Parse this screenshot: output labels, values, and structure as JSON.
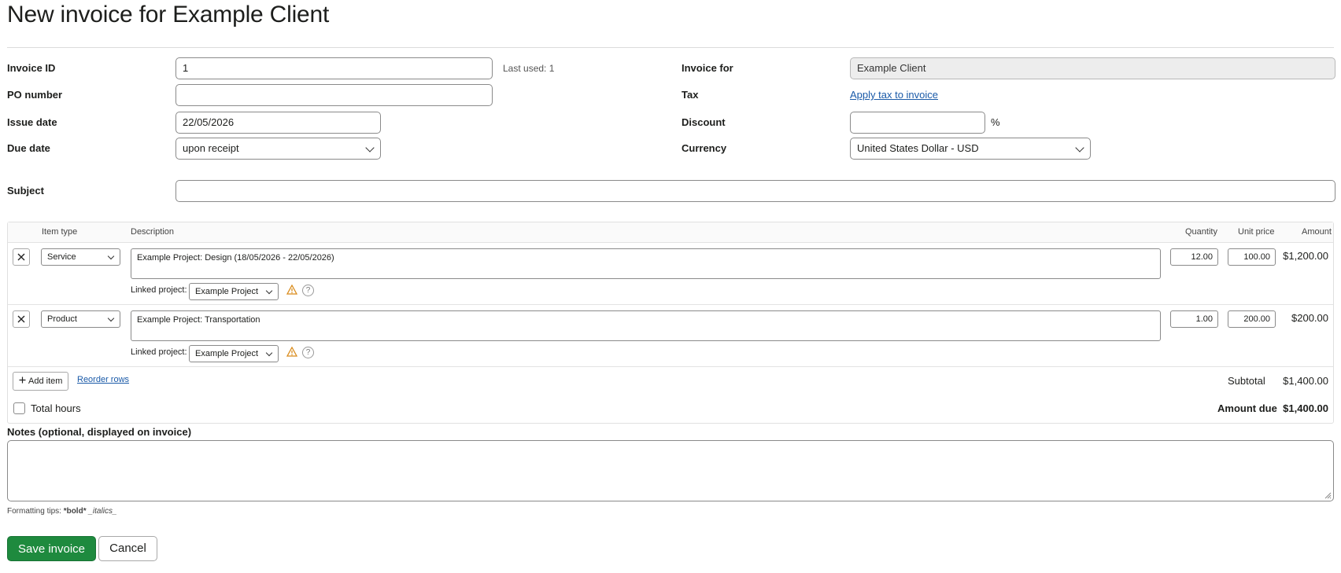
{
  "page": {
    "title": "New invoice for Example Client"
  },
  "form": {
    "invoice_id": {
      "label": "Invoice ID",
      "value": "1",
      "last_used": "Last used: 1"
    },
    "po_number": {
      "label": "PO number",
      "value": ""
    },
    "issue_date": {
      "label": "Issue date",
      "value": "22/05/2026"
    },
    "due_date": {
      "label": "Due date",
      "value": "upon receipt"
    },
    "invoice_for": {
      "label": "Invoice for",
      "value": "Example Client"
    },
    "tax": {
      "label": "Tax",
      "link": "Apply tax to invoice"
    },
    "discount": {
      "label": "Discount",
      "value": "",
      "suffix": "%"
    },
    "currency": {
      "label": "Currency",
      "value": "United States Dollar - USD"
    },
    "subject": {
      "label": "Subject",
      "value": ""
    }
  },
  "items": {
    "headers": {
      "item_type": "Item type",
      "description": "Description",
      "quantity": "Quantity",
      "unit_price": "Unit price",
      "amount": "Amount"
    },
    "rows": [
      {
        "remove_icon": "close-icon",
        "item_type": "Service",
        "description": "Example Project: Design (18/05/2026 - 22/05/2026)",
        "linked_label": "Linked project:",
        "linked_project": "Example Project",
        "quantity": "12.00",
        "unit_price": "100.00",
        "amount": "$1,200.00"
      },
      {
        "remove_icon": "close-icon",
        "item_type": "Product",
        "description": "Example Project: Transportation",
        "linked_label": "Linked project:",
        "linked_project": "Example Project",
        "quantity": "1.00",
        "unit_price": "200.00",
        "amount": "$200.00"
      }
    ],
    "add_item": "Add item",
    "reorder_rows": "Reorder rows",
    "total_hours": "Total hours",
    "subtotal_label": "Subtotal",
    "subtotal": "$1,400.00",
    "amount_due_label": "Amount due",
    "amount_due": "$1,400.00",
    "help_glyph": "?"
  },
  "notes": {
    "label": "Notes (optional, displayed on invoice)",
    "value": "",
    "tips_prefix": "Formatting tips:",
    "tips_bold": "*bold*",
    "tips_italic": "_italics_"
  },
  "actions": {
    "save": "Save invoice",
    "cancel": "Cancel"
  },
  "colors": {
    "primary": "#1e8a3e",
    "link": "#1a5aa8",
    "warning": "#d98b1b"
  }
}
